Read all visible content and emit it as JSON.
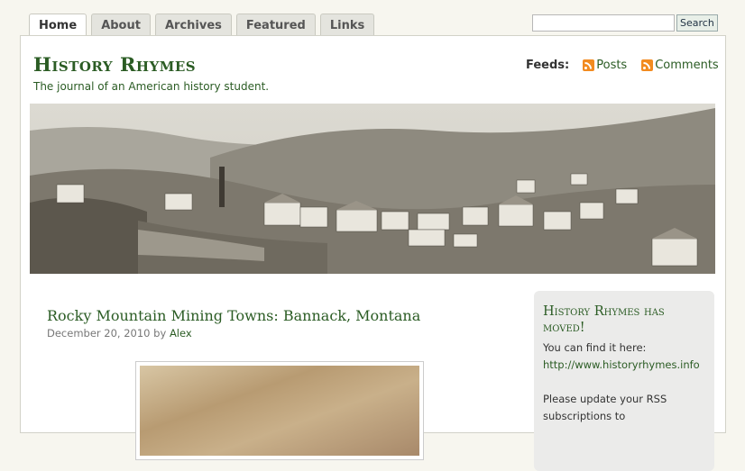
{
  "nav": {
    "tabs": [
      {
        "label": "Home"
      },
      {
        "label": "About"
      },
      {
        "label": "Archives"
      },
      {
        "label": "Featured"
      },
      {
        "label": "Links"
      }
    ]
  },
  "search": {
    "placeholder": "",
    "button_label": "Search"
  },
  "header": {
    "title": "History Rhymes",
    "tagline": "The journal of an American history student.",
    "feeds_label": "Feeds:",
    "feed_links": [
      {
        "label": "Posts",
        "icon": "rss-icon"
      },
      {
        "label": "Comments",
        "icon": "rss-icon"
      }
    ]
  },
  "post": {
    "title": "Rocky Mountain Mining Towns: Bannack, Montana",
    "date": "December 20, 2010",
    "by": "by",
    "author": "Alex"
  },
  "sidebar": {
    "title": "History Rhymes has moved!",
    "line1": "You can find it here:",
    "link": "http://www.historyrhymes.info",
    "line2": "Please update your RSS subscriptions to"
  },
  "colors": {
    "accent": "#2b5c24",
    "rss": "#f28b20",
    "page_bg": "#f7f6ef"
  }
}
